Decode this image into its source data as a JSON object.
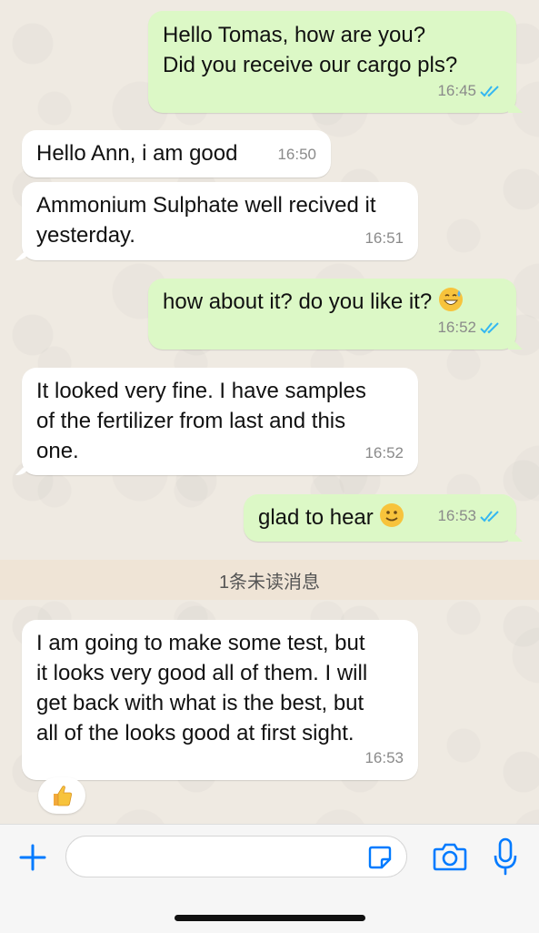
{
  "messages": [
    {
      "direction": "outgoing",
      "text": "Hello Tomas, how are you?\nDid you receive our cargo pls?",
      "time": "16:45",
      "status": "read"
    },
    {
      "direction": "incoming",
      "text": "Hello Ann, i am good",
      "time": "16:50"
    },
    {
      "direction": "incoming",
      "text": "Ammonium Sulphate well recived it\nyesterday.",
      "time": "16:51"
    },
    {
      "direction": "outgoing",
      "text": "how about it? do you like it?",
      "emoji": "grinning-sweat-emoji",
      "time": "16:52",
      "status": "read"
    },
    {
      "direction": "incoming",
      "text": "It looked very fine. I have samples\nof the fertilizer from last and this\none.",
      "time": "16:52"
    },
    {
      "direction": "outgoing",
      "text": "glad to hear",
      "emoji": "slightly-smiling-emoji",
      "time": "16:53",
      "status": "read"
    },
    {
      "direction": "incoming",
      "text": "I am going to make some test, but\nit looks very good all of them. I will\nget back with what is the best, but\nall of the looks good at first sight.",
      "time": "16:53",
      "reaction": "thumbs-up-emoji"
    }
  ],
  "unread_separator": "1条未读消息",
  "composer": {
    "value": "",
    "placeholder": ""
  },
  "colors": {
    "outgoing_bubble": "#dcf8c6",
    "incoming_bubble": "#ffffff",
    "read_ticks": "#34b7f1",
    "accent": "#007aff"
  },
  "icons": [
    "plus-icon",
    "sticker-icon",
    "camera-icon",
    "microphone-icon",
    "double-check-icon"
  ]
}
